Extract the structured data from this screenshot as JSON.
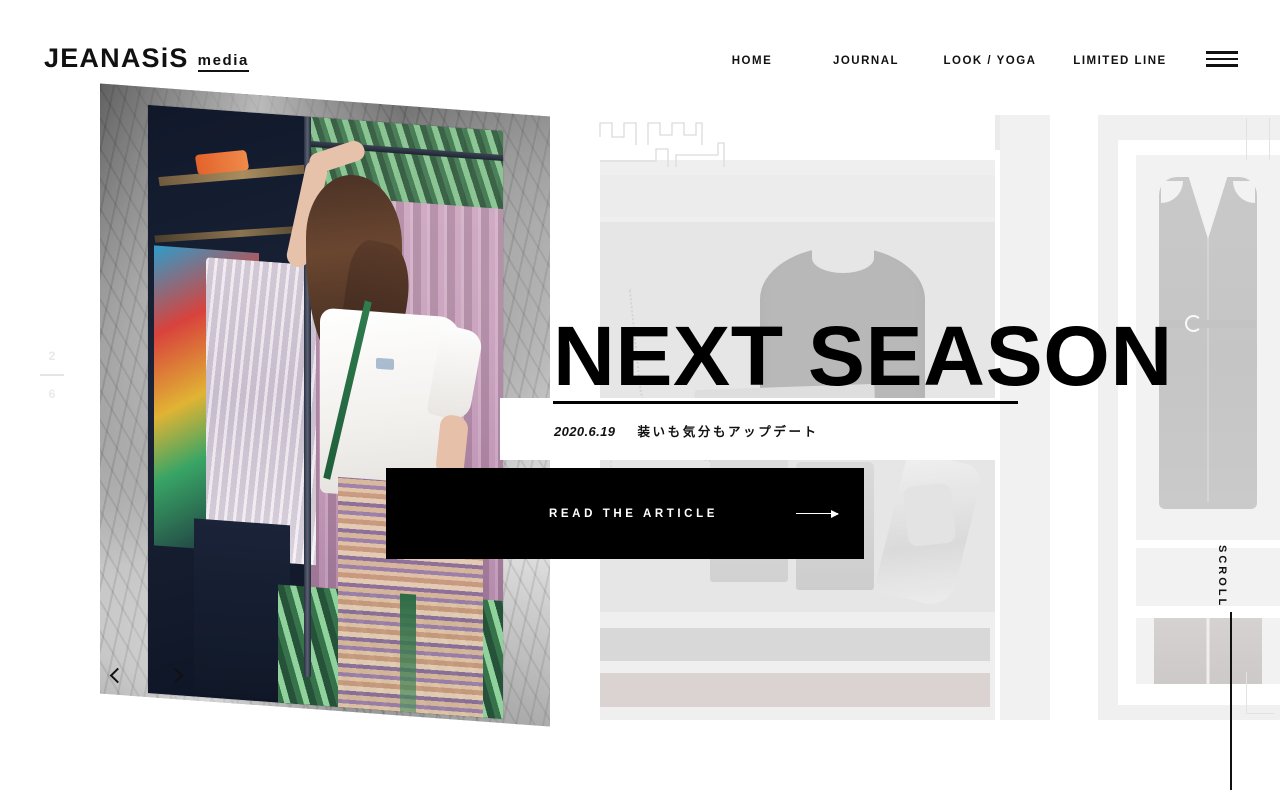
{
  "site": {
    "brand_primary": "JEANASiS",
    "brand_secondary": "media",
    "accent_color": "#000000",
    "background_color": "#ffffff"
  },
  "header": {
    "nav": [
      {
        "label": "HOME",
        "name": "nav-home"
      },
      {
        "label": "JOURNAL",
        "name": "nav-journal"
      },
      {
        "label": "LOOK / YOGA",
        "name": "nav-look-yoga"
      },
      {
        "label": "LIMITED LINE",
        "name": "nav-limited-line"
      }
    ],
    "menu_icon": "hamburger-menu-icon"
  },
  "hero": {
    "title": "NEXT SEASON",
    "date": "2020.6.19",
    "description": "装いも気分もアップデート",
    "cta_label": "READ THE ARTICLE",
    "cta_arrow_icon": "arrow-right-icon"
  },
  "carousel": {
    "current_slide": "2",
    "total_slides": "6",
    "prev_icon": "chevron-left-icon",
    "next_icon": "chevron-right-icon"
  },
  "scroll": {
    "label": "SCROLL"
  }
}
